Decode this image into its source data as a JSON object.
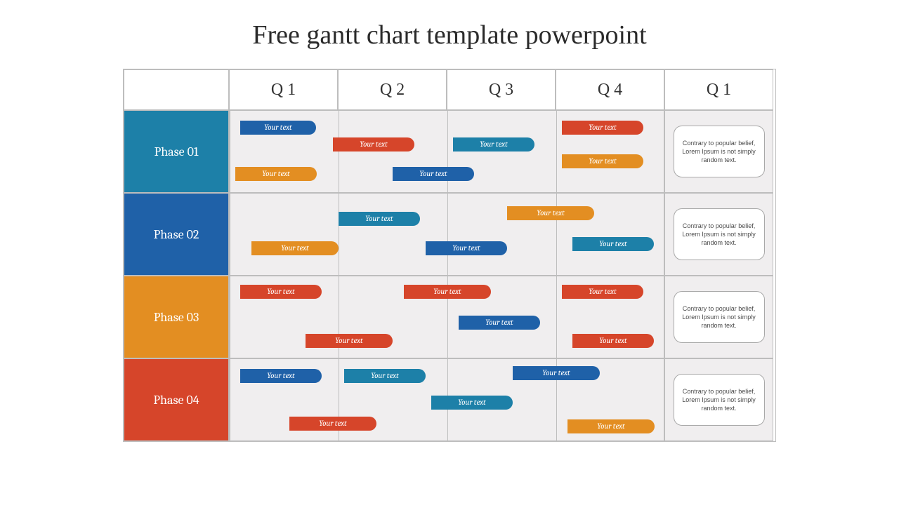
{
  "title": "Free gantt chart template powerpoint",
  "columns": {
    "c1": "Q 1",
    "c2": "Q 2",
    "c3": "Q 3",
    "c4": "Q 4",
    "c5": "Q 1"
  },
  "phases": {
    "p1": "Phase 01",
    "p2": "Phase 02",
    "p3": "Phase 03",
    "p4": "Phase 04"
  },
  "bar_label": "Your text",
  "note_text": "Contrary to popular belief, Lorem Ipsum is not simply random text.",
  "chart_data": {
    "type": "bar",
    "title": "Free gantt chart template powerpoint",
    "xlabel": "",
    "ylabel": "",
    "x_categories": [
      "Q 1",
      "Q 2",
      "Q 3",
      "Q 4",
      "Q 1"
    ],
    "y_categories": [
      "Phase 01",
      "Phase 02",
      "Phase 03",
      "Phase 04"
    ],
    "note": "Contrary to popular belief, Lorem Ipsum is not simply random text.",
    "series": [
      {
        "row": "Phase 01",
        "bars": [
          {
            "start": 0.1,
            "end": 0.8,
            "sub_row": 1,
            "color": "blue",
            "label": "Your text"
          },
          {
            "start": 0.95,
            "end": 1.7,
            "sub_row": 2,
            "color": "red",
            "label": "Your text"
          },
          {
            "start": 0.05,
            "end": 0.8,
            "sub_row": 3,
            "color": "orange",
            "label": "Your text"
          },
          {
            "start": 1.5,
            "end": 2.25,
            "sub_row": 3,
            "color": "blue",
            "label": "Your text"
          },
          {
            "start": 2.05,
            "end": 2.8,
            "sub_row": 2,
            "color": "steel",
            "label": "Your text"
          },
          {
            "start": 3.05,
            "end": 3.8,
            "sub_row": 1,
            "color": "red",
            "label": "Your text"
          },
          {
            "start": 3.05,
            "end": 3.8,
            "sub_row": 3,
            "color": "orange",
            "label": "Your text"
          }
        ]
      },
      {
        "row": "Phase 02",
        "bars": [
          {
            "start": 1.0,
            "end": 1.75,
            "sub_row": 1,
            "color": "steel",
            "label": "Your text"
          },
          {
            "start": 0.2,
            "end": 1.0,
            "sub_row": 2,
            "color": "orange",
            "label": "Your text"
          },
          {
            "start": 1.8,
            "end": 2.55,
            "sub_row": 2,
            "color": "blue",
            "label": "Your text"
          },
          {
            "start": 2.55,
            "end": 3.35,
            "sub_row": 1,
            "color": "orange",
            "label": "Your text"
          },
          {
            "start": 3.15,
            "end": 3.9,
            "sub_row": 2,
            "color": "steel",
            "label": "Your text"
          }
        ]
      },
      {
        "row": "Phase 03",
        "bars": [
          {
            "start": 0.1,
            "end": 0.85,
            "sub_row": 1,
            "color": "red",
            "label": "Your text"
          },
          {
            "start": 1.6,
            "end": 2.4,
            "sub_row": 1,
            "color": "red",
            "label": "Your text"
          },
          {
            "start": 0.7,
            "end": 1.5,
            "sub_row": 3,
            "color": "red",
            "label": "Your text"
          },
          {
            "start": 2.1,
            "end": 2.85,
            "sub_row": 2,
            "color": "blue",
            "label": "Your text"
          },
          {
            "start": 3.05,
            "end": 3.8,
            "sub_row": 1,
            "color": "red",
            "label": "Your text"
          },
          {
            "start": 3.15,
            "end": 3.9,
            "sub_row": 3,
            "color": "red",
            "label": "Your text"
          }
        ]
      },
      {
        "row": "Phase 04",
        "bars": [
          {
            "start": 0.1,
            "end": 0.85,
            "sub_row": 1,
            "color": "blue",
            "label": "Your text"
          },
          {
            "start": 1.05,
            "end": 1.8,
            "sub_row": 1,
            "color": "steel",
            "label": "Your text"
          },
          {
            "start": 0.55,
            "end": 1.35,
            "sub_row": 3,
            "color": "red",
            "label": "Your text"
          },
          {
            "start": 1.85,
            "end": 2.6,
            "sub_row": 2,
            "color": "steel",
            "label": "Your text"
          },
          {
            "start": 2.6,
            "end": 3.4,
            "sub_row": 1,
            "color": "blue",
            "label": "Your text"
          },
          {
            "start": 3.1,
            "end": 3.9,
            "sub_row": 3,
            "color": "orange",
            "label": "Your text"
          }
        ]
      }
    ]
  }
}
